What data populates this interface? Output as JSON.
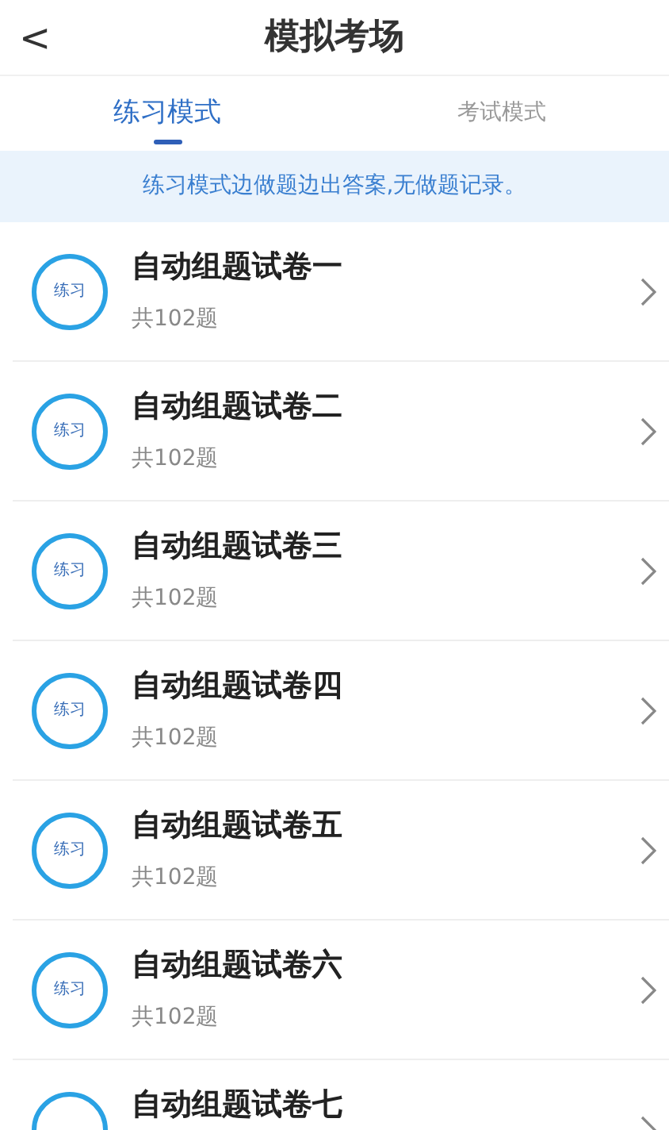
{
  "header": {
    "back": "<",
    "title": "模拟考场"
  },
  "tabs": [
    {
      "label": "练习模式",
      "selected": true
    },
    {
      "label": "考试模式",
      "selected": false
    }
  ],
  "notice": "练习模式边做题边出答案,无做题记录。",
  "papers": [
    {
      "badge": "练习",
      "title": "自动组题试卷一",
      "count": "共102题"
    },
    {
      "badge": "练习",
      "title": "自动组题试卷二",
      "count": "共102题"
    },
    {
      "badge": "练习",
      "title": "自动组题试卷三",
      "count": "共102题"
    },
    {
      "badge": "练习",
      "title": "自动组题试卷四",
      "count": "共102题"
    },
    {
      "badge": "练习",
      "title": "自动组题试卷五",
      "count": "共102题"
    },
    {
      "badge": "练习",
      "title": "自动组题试卷六",
      "count": "共102题"
    },
    {
      "title": "自动组题试卷七"
    }
  ]
}
